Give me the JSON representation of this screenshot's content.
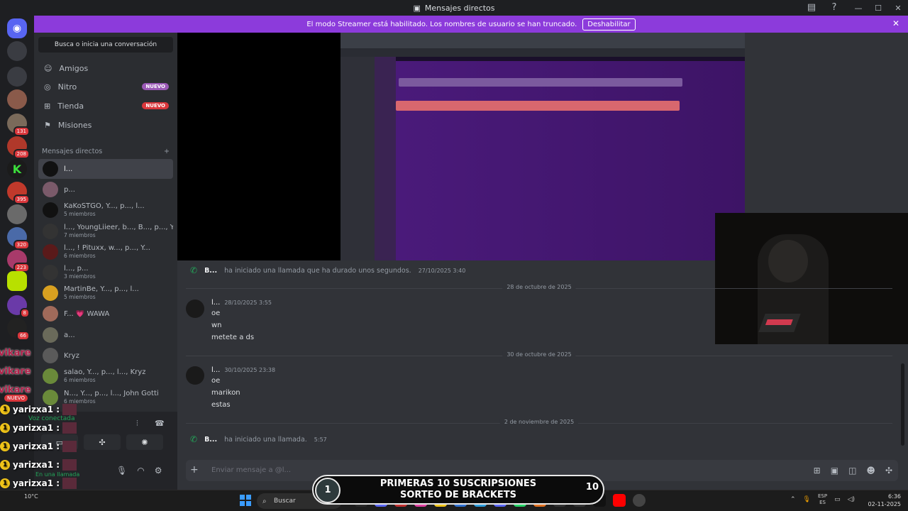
{
  "window": {
    "title": "Mensajes directos"
  },
  "banner": {
    "text": "El modo Streamer está habilitado. Los nombres de usuario se han truncado.",
    "button": "Deshabilitar"
  },
  "servers": [
    {
      "badge": ""
    },
    {
      "badge": ""
    },
    {
      "badge": ""
    },
    {
      "badge": ""
    },
    {
      "badge": "131"
    },
    {
      "badge": "208"
    },
    {
      "badge": ""
    },
    {
      "badge": "395"
    },
    {
      "badge": ""
    },
    {
      "badge": "320"
    },
    {
      "badge": "223"
    },
    {
      "badge": ""
    },
    {
      "badge": "8"
    },
    {
      "badge": "66"
    }
  ],
  "sidebar": {
    "search": "Busca o inicia una conversación",
    "nav": [
      {
        "label": "Amigos",
        "badge": ""
      },
      {
        "label": "Nitro",
        "badge": "NUEVO"
      },
      {
        "label": "Tienda",
        "badge": "NUEVO"
      },
      {
        "label": "Misiones",
        "badge": ""
      }
    ],
    "dm_header": "Mensajes directos",
    "dm_add": "+",
    "dms": [
      {
        "name": "l...",
        "sub": ""
      },
      {
        "name": "p...",
        "sub": ""
      },
      {
        "name": "KaKoSTGO, Y..., p..., l...",
        "sub": "5 miembros"
      },
      {
        "name": "l..., YoungLiieer, b..., B..., p..., Y...",
        "sub": "7 miembros"
      },
      {
        "name": "l..., ! Pituxx, w..., p..., Y...",
        "sub": "6 miembros"
      },
      {
        "name": "l..., p...",
        "sub": "3 miembros"
      },
      {
        "name": "MartinBe, Y..., p..., l...",
        "sub": "5 miembros"
      },
      {
        "name": "F...  💗 WAWA",
        "sub": ""
      },
      {
        "name": "a...",
        "sub": ""
      },
      {
        "name": "Kryz",
        "sub": ""
      },
      {
        "name": "salao, Y..., p..., l..., Kryz",
        "sub": "6 miembros"
      },
      {
        "name": "N..., Y..., p..., l..., John Gotti",
        "sub": "6 miembros"
      }
    ],
    "voice_connected": "Voz conectada",
    "in_call": "En una llamada"
  },
  "messages": {
    "call1": {
      "author": "B...",
      "text": "ha iniciado una llamada que ha durado unos segundos.",
      "time": "27/10/2025 3:40"
    },
    "date1": "28 de octubre de 2025",
    "msg1": {
      "author": "l...",
      "time": "28/10/2025 3:55",
      "lines": [
        "oe",
        "wn",
        "metete a ds"
      ]
    },
    "date2": "30 de octubre de 2025",
    "msg2": {
      "author": "l...",
      "time": "30/10/2025 23:38",
      "lines": [
        "oe",
        "marikon",
        "estas"
      ]
    },
    "date3": "2 de noviembre de 2025",
    "call2": {
      "author": "B...",
      "text": "ha iniciado una llamada.",
      "time": "5:57"
    },
    "composer_placeholder": "Enviar mensaje a @l..."
  },
  "overlay": {
    "sub_line1": "PRIMERAS 10 SUSCRIPSIONES",
    "sub_line2": "SORTEO DE BRACKETS",
    "counter_left": "1",
    "counter_right": "10",
    "chat_user": "yarizxa1 :",
    "chat_name_red": "vikare",
    "chat_new": "NUEVO"
  },
  "taskbar": {
    "weather": "10°C",
    "search": "Buscar",
    "lang_top": "ESP",
    "lang_bottom": "ES",
    "time": "6:36",
    "date": "02-11-2025"
  },
  "colors": {
    "accent": "#8c3bdb",
    "discord": "#5865f2",
    "green": "#23a559",
    "red": "#da373c"
  }
}
